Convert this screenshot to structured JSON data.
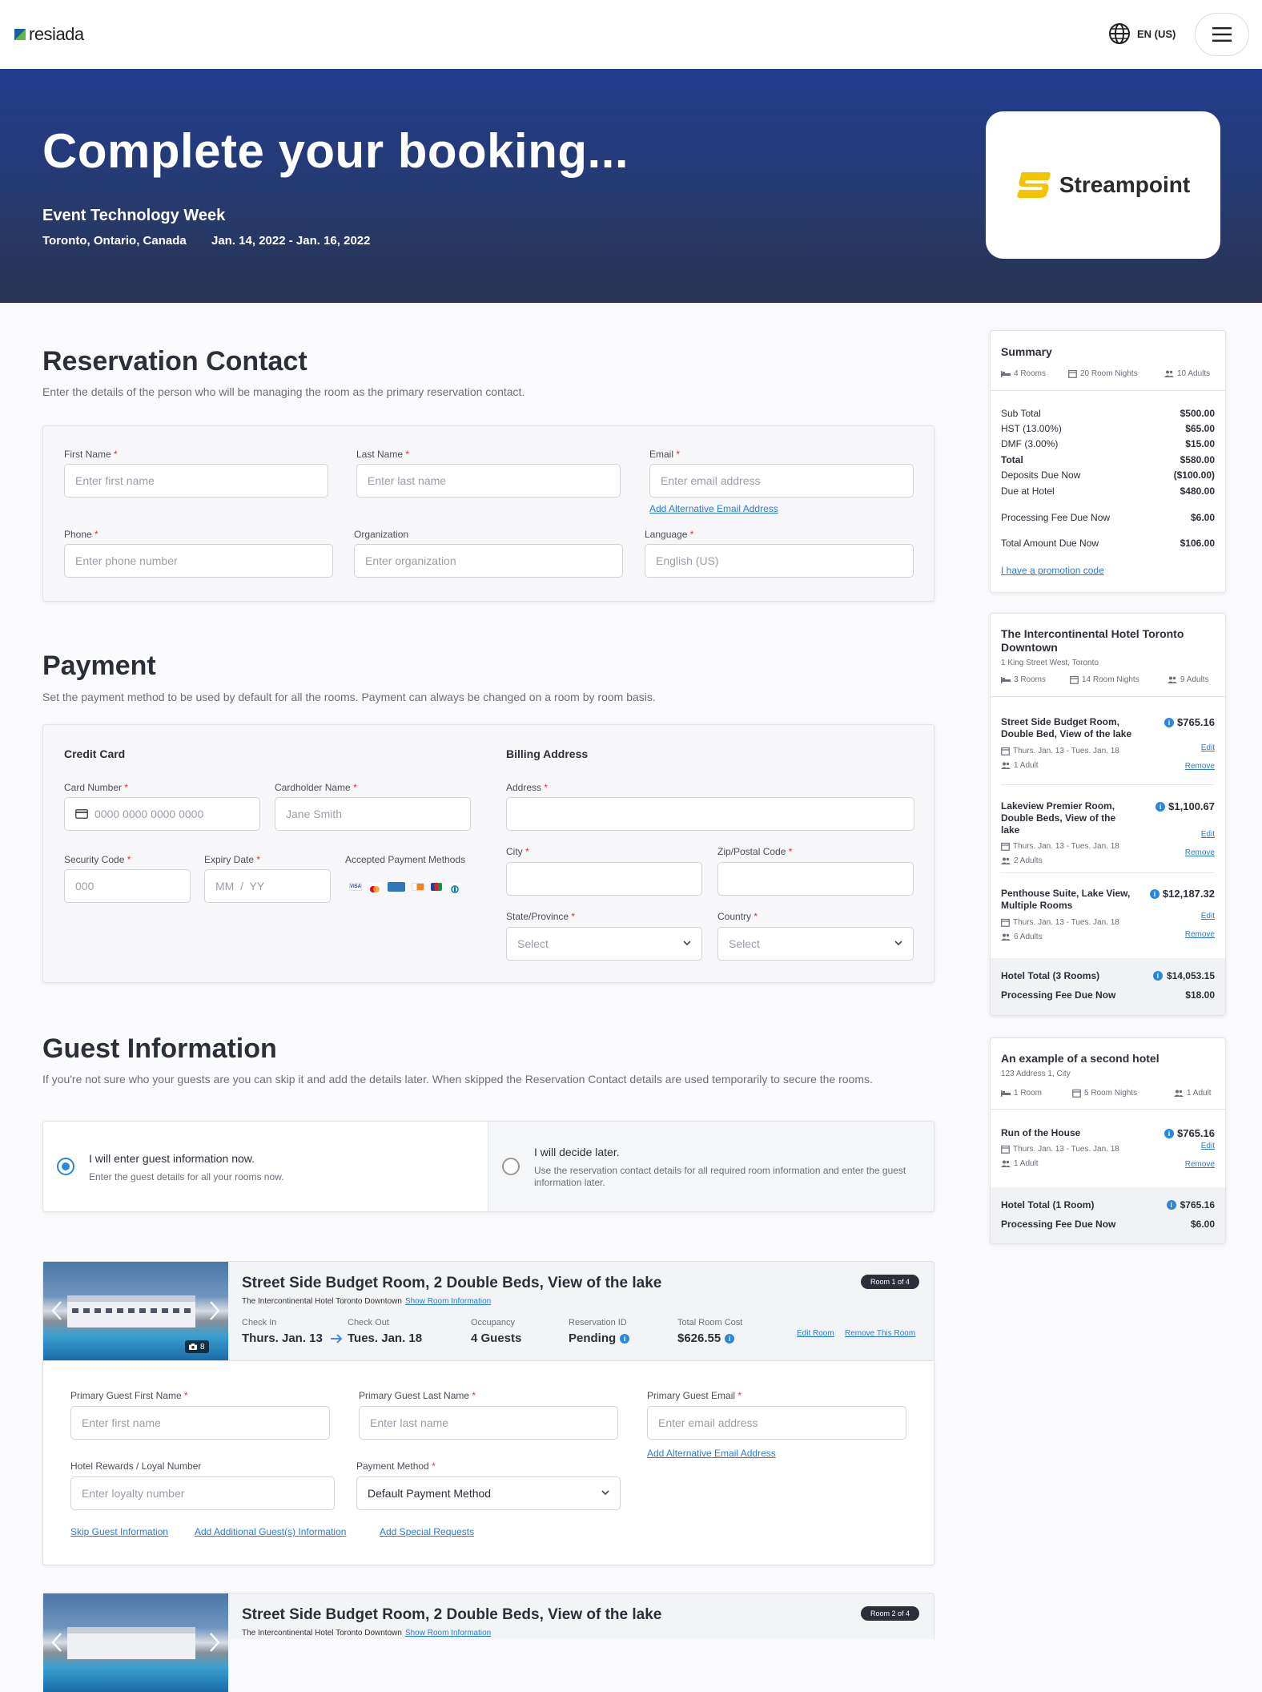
{
  "header": {
    "logo_text": "resiada",
    "language": "EN (US)"
  },
  "hero": {
    "title": "Complete your booking...",
    "event": "Event Technology Week",
    "location": "Toronto, Ontario, Canada",
    "dates": "Jan. 14, 2022 - Jan. 16, 2022",
    "sponsor": "Streampoint"
  },
  "contact": {
    "title": "Reservation Contact",
    "subtitle": "Enter the details of the person who will be managing the room as the primary reservation contact.",
    "first_name_label": "First Name",
    "first_name_ph": "Enter first name",
    "last_name_label": "Last Name",
    "last_name_ph": "Enter last name",
    "email_label": "Email",
    "email_ph": "Enter email address",
    "alt_email_link": "Add Alternative Email Address",
    "phone_label": "Phone",
    "phone_ph": "Enter phone number",
    "org_label": "Organization",
    "org_ph": "Enter organization",
    "language_label": "Language",
    "language_value": "English (US)"
  },
  "payment": {
    "title": "Payment",
    "subtitle": "Set the payment method to be used by default for all the rooms. Payment can always be changed on a room by room basis.",
    "cc_heading": "Credit Card",
    "card_number_label": "Card Number",
    "card_number_ph": "0000 0000 0000 0000",
    "cardholder_label": "Cardholder Name",
    "cardholder_ph": "Jane Smith",
    "security_label": "Security Code",
    "security_ph": "000",
    "expiry_label": "Expiry Date",
    "expiry_ph": "MM  /  YY",
    "accepted_label": "Accepted Payment Methods",
    "billing_heading": "Billing Address",
    "address_label": "Address",
    "city_label": "City",
    "zip_label": "Zip/Postal Code",
    "state_label": "State/Province",
    "state_value": "Select",
    "country_label": "Country",
    "country_value": "Select"
  },
  "guest": {
    "title": "Guest Information",
    "subtitle": "If you're not sure who your guests are you can skip it and add the details later. When skipped the Reservation Contact details are used temporarily to secure the rooms.",
    "option_now_title": "I will enter guest information now.",
    "option_now_sub": "Enter the guest details for all your rooms now.",
    "option_later_title": "I will decide later.",
    "option_later_sub": "Use the reservation contact details for all required room information and enter the guest information later."
  },
  "rooms": [
    {
      "title": "Street Side Budget Room, 2 Double Beds, View of the lake",
      "hotel": "The Intercontinental Hotel Toronto Downtown",
      "show_info": "Show Room Information",
      "badge": "Room 1 of 4",
      "photo_count": "8",
      "check_in_label": "Check In",
      "check_in": "Thurs. Jan. 13",
      "check_out_label": "Check Out",
      "check_out": "Tues. Jan. 18",
      "occupancy_label": "Occupancy",
      "occupancy": "4 Guests",
      "resid_label": "Reservation ID",
      "resid": "Pending",
      "cost_label": "Total Room Cost",
      "cost": "$626.55",
      "edit_room": "Edit Room",
      "remove_room": "Remove This Room",
      "pg_first_label": "Primary Guest First Name",
      "pg_first_ph": "Enter first name",
      "pg_last_label": "Primary Guest Last Name",
      "pg_last_ph": "Enter last name",
      "pg_email_label": "Primary Guest Email",
      "pg_email_ph": "Enter email address",
      "alt_email_link": "Add Alternative Email Address",
      "loyalty_label": "Hotel Rewards / Loyal Number",
      "loyalty_ph": "Enter loyalty number",
      "pay_method_label": "Payment Method",
      "pay_method_value": "Default Payment Method",
      "skip_link": "Skip Guest Information",
      "add_guest_link": "Add Additional Guest(s) Information",
      "special_link": "Add Special Requests"
    },
    {
      "title": "Street Side Budget Room, 2 Double Beds, View of the lake",
      "hotel": "The Intercontinental Hotel Toronto Downtown",
      "show_info": "Show Room Information",
      "badge": "Room 2 of 4"
    }
  ],
  "summary": {
    "title": "Summary",
    "rooms": "4 Rooms",
    "nights": "20 Room Nights",
    "adults": "10 Adults",
    "rows": [
      {
        "label": "Sub Total",
        "value": "$500.00"
      },
      {
        "label": "HST (13.00%)",
        "value": "$65.00"
      },
      {
        "label": "DMF (3.00%)",
        "value": "$15.00"
      },
      {
        "label": "Total",
        "value": "$580.00"
      },
      {
        "label": "Deposits Due Now",
        "value": "($100.00)"
      },
      {
        "label": "Due at Hotel",
        "value": "$480.00"
      }
    ],
    "proc_label": "Processing Fee Due Now",
    "proc_value": "$6.00",
    "due_label": "Total Amount Due Now",
    "due_value": "$106.00",
    "promo_link": "I have a promotion code"
  },
  "hotel1": {
    "title": "The Intercontinental Hotel Toronto Downtown",
    "address": "1 King Street West, Toronto",
    "rooms": "3 Rooms",
    "nights": "14 Room Nights",
    "adults": "9 Adults",
    "items": [
      {
        "name": "Street Side Budget Room, Double Bed, View of the lake",
        "price": "$765.16",
        "dates": "Thurs. Jan. 13 - Tues. Jan. 18",
        "guests": "1 Adult"
      },
      {
        "name": "Lakeview Premier Room, Double Beds, View of the lake",
        "price": "$1,100.67",
        "dates": "Thurs. Jan. 13 - Tues. Jan. 18",
        "guests": "2 Adults"
      },
      {
        "name": "Penthouse Suite, Lake View, Multiple Rooms",
        "price": "$12,187.32",
        "dates": "Thurs. Jan. 13 - Tues. Jan. 18",
        "guests": "6 Adults"
      }
    ],
    "edit": "Edit",
    "remove": "Remove",
    "total_label": "Hotel Total (3 Rooms)",
    "total_value": "$14,053.15",
    "proc_label": "Processing Fee Due Now",
    "proc_value": "$18.00"
  },
  "hotel2": {
    "title": "An example of a second hotel",
    "address": "123 Address 1, City",
    "rooms": "1 Room",
    "nights": "5 Room Nights",
    "adults": "1 Adult",
    "items": [
      {
        "name": "Run of the House",
        "price": "$765.16",
        "dates": "Thurs. Jan. 13 - Tues. Jan. 18",
        "guests": "1 Adult"
      }
    ],
    "edit": "Edit",
    "remove": "Remove",
    "total_label": "Hotel Total (1 Room)",
    "total_value": "$765.16",
    "proc_label": "Processing Fee Due Now",
    "proc_value": "$6.00"
  }
}
